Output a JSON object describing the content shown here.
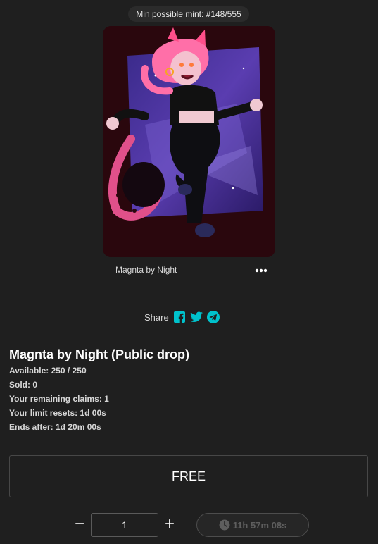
{
  "badge": {
    "text": "Min possible mint: #148/555"
  },
  "card": {
    "title": "Magnta by Night"
  },
  "share": {
    "label": "Share"
  },
  "drop": {
    "title": "Magnta by Night (Public drop)",
    "available": "Available: 250 / 250",
    "sold": "Sold: 0",
    "remaining_claims": "Your remaining claims: 1",
    "limit_resets": "Your limit resets: 1d 00s",
    "ends_after": "Ends after: 1d 20m 00s"
  },
  "purchase": {
    "button_label": "FREE",
    "minus": "−",
    "plus": "+",
    "quantity": "1",
    "timer": "11h 57m 08s"
  },
  "colors": {
    "accent": "#00c2cc",
    "background": "#1f1f1f"
  },
  "icons": [
    "more-icon",
    "facebook-icon",
    "twitter-icon",
    "telegram-icon",
    "clock-icon"
  ]
}
